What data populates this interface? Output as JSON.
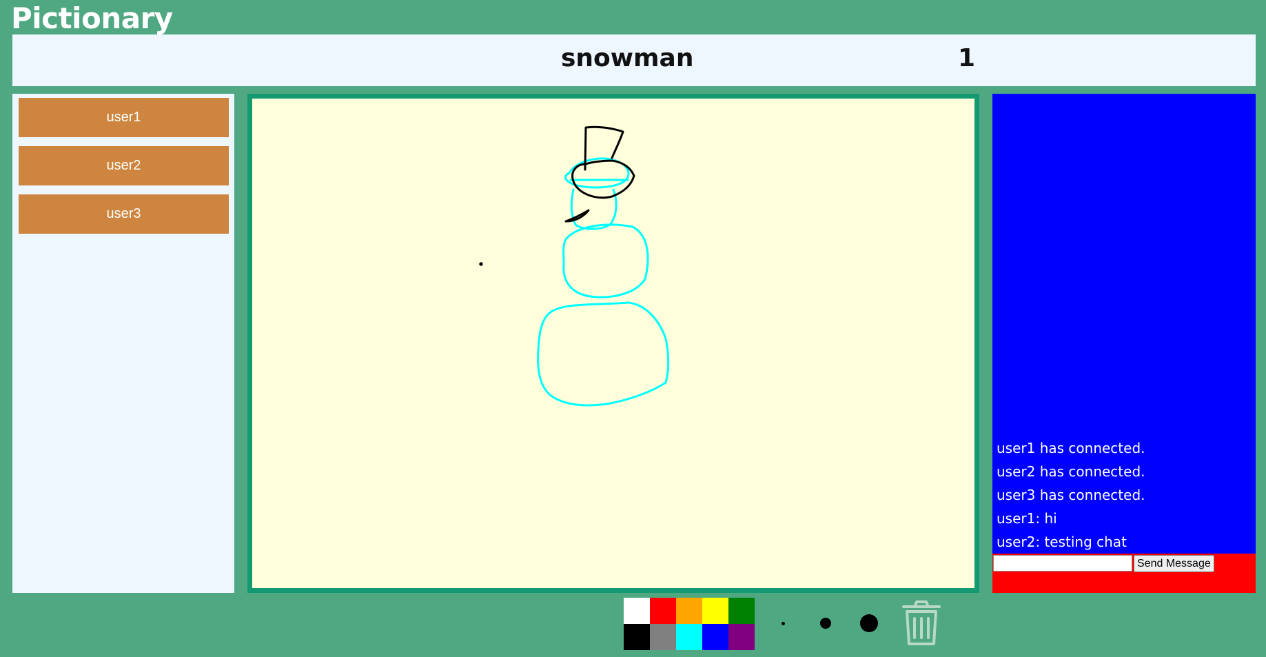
{
  "app": {
    "title": "Pictionary"
  },
  "game": {
    "word": "snowman",
    "round": "1"
  },
  "users": [
    {
      "name": "user1"
    },
    {
      "name": "user2"
    },
    {
      "name": "user3"
    }
  ],
  "chat": {
    "messages": [
      "user1 has connected.",
      "user2 has connected.",
      "user3 has connected.",
      "user1: hi",
      "user2: testing chat"
    ],
    "input_value": "",
    "send_label": "Send Message"
  },
  "palette": {
    "colors": [
      "#ffffff",
      "#ff0000",
      "#ffa500",
      "#ffff00",
      "#008000",
      "#000000",
      "#808080",
      "#00ffff",
      "#0000ff",
      "#800080"
    ]
  },
  "brushes": [
    "small",
    "medium",
    "large"
  ],
  "icons": {
    "clear": "trash-icon"
  },
  "theme": {
    "background": "#4fa882",
    "user_button": "#cd853f",
    "chat_background": "#0000ff",
    "chat_form_background": "#ff0000",
    "canvas_background": "#ffffdc",
    "canvas_border": "#159970"
  }
}
